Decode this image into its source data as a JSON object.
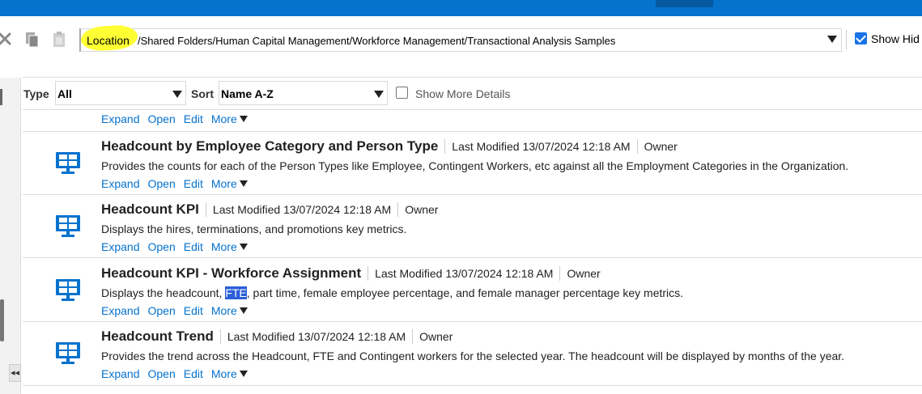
{
  "colors": {
    "brand_blue": "#0572ce",
    "link": "#0572ce",
    "highlight": "#ffff33",
    "selection": "#2b5fd9"
  },
  "toolbar": {
    "icons": [
      "close-icon",
      "copy-icon",
      "paste-icon"
    ],
    "location_label": "Location",
    "location_path": "/Shared Folders/Human Capital Management/Workforce Management/Transactional Analysis Samples",
    "show_hidden_label": "Show Hid",
    "show_hidden_checked": true
  },
  "filters": {
    "type_label": "Type",
    "type_value": "All",
    "sort_label": "Sort",
    "sort_value": "Name A-Z",
    "more_details_label": "Show More Details",
    "more_details_checked": false
  },
  "actions": {
    "expand": "Expand",
    "open": "Open",
    "edit": "Edit",
    "more": "More"
  },
  "items": [
    {
      "title": "Headcount by Employee Category and Person Type",
      "modified": "Last Modified 13/07/2024 12:18 AM",
      "owner": "Owner",
      "description": "Provides the counts for each of the Person Types like Employee, Contingent Workers, etc against all the Employment Categories in the Organization."
    },
    {
      "title": "Headcount KPI",
      "modified": "Last Modified 13/07/2024 12:18 AM",
      "owner": "Owner",
      "description": "Displays the hires, terminations, and promotions key metrics."
    },
    {
      "title": "Headcount KPI - Workforce Assignment",
      "modified": "Last Modified 13/07/2024 12:18 AM",
      "owner": "Owner",
      "description_pre": "Displays the headcount, ",
      "description_sel": "FTE",
      "description_post": ", part time, female employee percentage, and female manager percentage key metrics."
    },
    {
      "title": "Headcount Trend",
      "modified": "Last Modified 13/07/2024 12:18 AM",
      "owner": "Owner",
      "description": "Provides the trend across the Headcount, FTE and Contingent workers for the selected year. The headcount will be displayed by months of the year."
    }
  ]
}
